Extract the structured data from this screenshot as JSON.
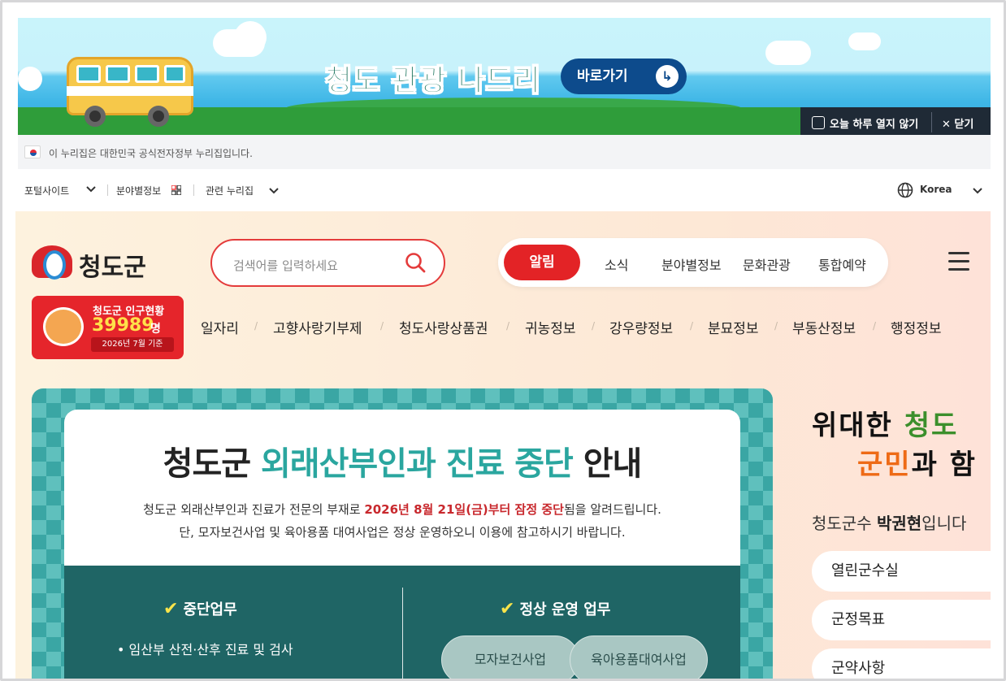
{
  "banner": {
    "title": "청도 관광 나드리",
    "button_label": "바로가기",
    "button_icon": "arrow-return-icon",
    "colors": {
      "title": "#0c6b52",
      "button_bg": "#0d4b8c",
      "sky": "#c9f4fb",
      "sea": "#3eb6e6",
      "grass": "#2f9d3a"
    }
  },
  "popup_bar": {
    "dont_show_today": "오늘 하루 열지 않기",
    "close": "닫기"
  },
  "gov_strip": {
    "text": "이 누리집은 대한민국 공식전자정부 누리집입니다."
  },
  "utility_bar": {
    "portal": "포털사이트",
    "field_info": "분야별정보",
    "related": "관련 누리집",
    "language": "Korea"
  },
  "header": {
    "logo_text": "청도군",
    "search_placeholder": "검색어를 입력하세요",
    "nav": [
      "알림",
      "소식",
      "분야별정보",
      "문화관광",
      "통합예약"
    ],
    "active_nav": "알림",
    "brand_color": "#e32326"
  },
  "population_card": {
    "title": "청도군 인구현황",
    "count": "39989",
    "unit": "명",
    "date": "2026년 7월 기준"
  },
  "subnav": [
    "일자리",
    "고향사랑기부제",
    "청도사랑상품권",
    "귀농정보",
    "강우량정보",
    "분묘정보",
    "부동산정보",
    "행정정보"
  ],
  "notice": {
    "title_a": "청도군 ",
    "title_b": "외래산부인과 진료 중단",
    "title_c": " 안내",
    "line1_a": "청도군 외래산부인과 진료가 전문의 부재로 ",
    "line1_b": "2026년 8월 21일(금)부터 잠정 중단",
    "line1_c": "됨을 알려드립니다.",
    "line2": "단, 모자보건사업 및 육아용품 대여사업은 정상 운영하오니 이용에 참고하시기 바랍니다.",
    "col1_heading": "중단업무",
    "col1_items": [
      "• 임산부 산전·산후 진료 및 검사"
    ],
    "col2_heading": "정상 운영 업무",
    "col2_items": [
      "모자보건사업",
      "육아용품대여사업"
    ],
    "accent": "#2aa69f"
  },
  "side": {
    "slogan_1a": "위대한 ",
    "slogan_1b": "청도",
    "slogan_2a": "군민",
    "slogan_2b": "과 함",
    "mayor_prefix": "청도군수 ",
    "mayor_name": "박권현",
    "mayor_suffix": "입니다",
    "links": [
      "열린군수실",
      "군정목표",
      "군약사항"
    ]
  }
}
